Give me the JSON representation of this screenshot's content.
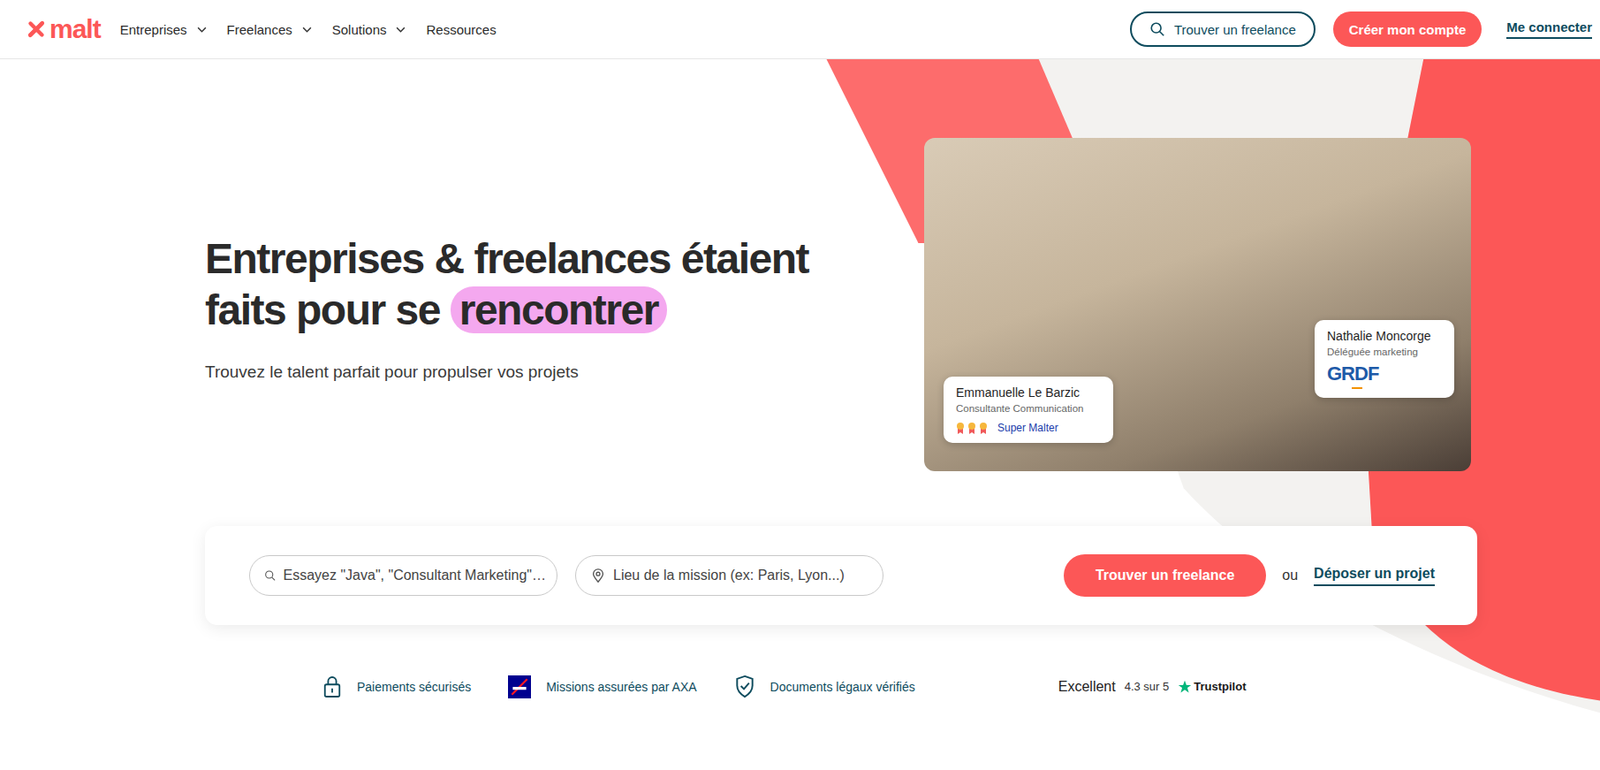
{
  "header": {
    "logo": "malt",
    "nav": [
      {
        "label": "Entreprises",
        "dropdown": true
      },
      {
        "label": "Freelances",
        "dropdown": true
      },
      {
        "label": "Solutions",
        "dropdown": true
      },
      {
        "label": "Ressources",
        "dropdown": false
      }
    ],
    "find_button": "Trouver un freelance",
    "signup_button": "Créer mon compte",
    "login_link": "Me connecter"
  },
  "hero": {
    "title_line1": "Entreprises & freelances étaient",
    "title_line2": "faits pour se",
    "title_highlight": "rencontrer",
    "subtitle": "Trouvez le talent parfait pour propulser vos projets"
  },
  "photo_cards": [
    {
      "name": "Emmanuelle Le Barzic",
      "role": "Consultante Communication",
      "badge": "Super Malter",
      "medals": 3,
      "company": ""
    },
    {
      "name": "Nathalie Moncorge",
      "role": "Déléguée marketing",
      "badge": "",
      "medals": 0,
      "company": "GRDF"
    }
  ],
  "search": {
    "query_placeholder": "Essayez \"Java\", \"Consultant Marketing\"…",
    "location_placeholder": "Lieu de la mission (ex: Paris, Lyon...)",
    "submit": "Trouver un freelance",
    "or": "ou",
    "post_project": "Déposer un projet"
  },
  "trust": [
    {
      "label": "Paiements sécurisés",
      "kind": "lock"
    },
    {
      "label": "Missions assurées par AXA",
      "kind": "axa"
    },
    {
      "label": "Documents légaux vérifiés",
      "kind": "shield"
    }
  ],
  "trustpilot": {
    "rating_word": "Excellent",
    "score": "4.3 sur 5",
    "brand": "Trustpilot"
  }
}
